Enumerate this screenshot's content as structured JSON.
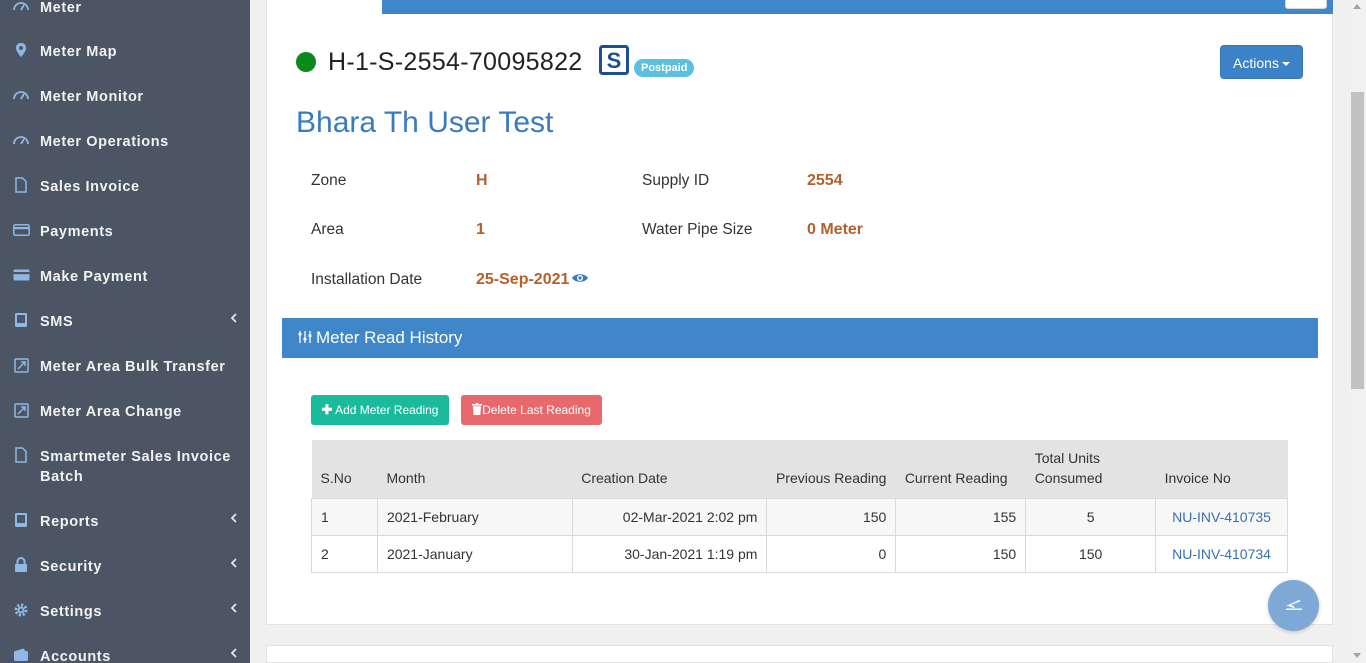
{
  "sidebar": {
    "items": [
      {
        "label": "Meter",
        "icon": "dashboard-icon",
        "chevron": false
      },
      {
        "label": "Meter Map",
        "icon": "map-marker-icon",
        "chevron": false
      },
      {
        "label": "Meter Monitor",
        "icon": "dashboard-icon",
        "chevron": false
      },
      {
        "label": "Meter Operations",
        "icon": "dashboard-icon",
        "chevron": false
      },
      {
        "label": "Sales Invoice",
        "icon": "file-icon",
        "chevron": false
      },
      {
        "label": "Payments",
        "icon": "credit-card-icon",
        "chevron": false
      },
      {
        "label": "Make Payment",
        "icon": "credit-card-icon",
        "chevron": false
      },
      {
        "label": "SMS",
        "icon": "tablet-icon",
        "chevron": true
      },
      {
        "label": "Meter Area Bulk Transfer",
        "icon": "external-link-icon",
        "chevron": false
      },
      {
        "label": "Meter Area Change",
        "icon": "external-link-icon",
        "chevron": false
      },
      {
        "label": "Smartmeter Sales Invoice Batch",
        "icon": "file-icon",
        "chevron": false
      },
      {
        "label": "Reports",
        "icon": "tablet-icon",
        "chevron": true
      },
      {
        "label": "Security",
        "icon": "lock-icon",
        "chevron": true
      },
      {
        "label": "Settings",
        "icon": "gear-icon",
        "chevron": true
      },
      {
        "label": "Accounts",
        "icon": "wallet-icon",
        "chevron": true
      }
    ]
  },
  "header": {
    "meter_id": "H-1-S-2554-70095822",
    "badge": "Postpaid",
    "actions_label": "Actions",
    "customer_name": "Bhara Th User Test",
    "status_color": "#0b8a1a"
  },
  "info": {
    "zone_label": "Zone",
    "zone_value": "H",
    "supply_label": "Supply ID",
    "supply_value": "2554",
    "area_label": "Area",
    "area_value": "1",
    "pipe_label": "Water Pipe Size",
    "pipe_value": "0 Meter",
    "install_label": "Installation Date",
    "install_value": "25-Sep-2021"
  },
  "section": {
    "title": "Meter Read History",
    "add_label": "Add Meter Reading",
    "delete_label": "Delete Last Reading"
  },
  "table": {
    "headers": [
      "S.No",
      "Month",
      "Creation Date",
      "Previous Reading",
      "Current Reading",
      "Total Units Consumed",
      "Invoice No"
    ],
    "rows": [
      [
        "1",
        "2021-February",
        "02-Mar-2021 2:02 pm",
        "150",
        "155",
        "5",
        "NU-INV-410735"
      ],
      [
        "2",
        "2021-January",
        "30-Jan-2021 1:19 pm",
        "0",
        "150",
        "150",
        "NU-INV-410734"
      ]
    ]
  },
  "colors": {
    "sidebar_bg": "#4b5563",
    "accent": "#3f87c9",
    "value": "#b5602c",
    "add_btn": "#1abb9c",
    "delete_btn": "#e8696b"
  }
}
